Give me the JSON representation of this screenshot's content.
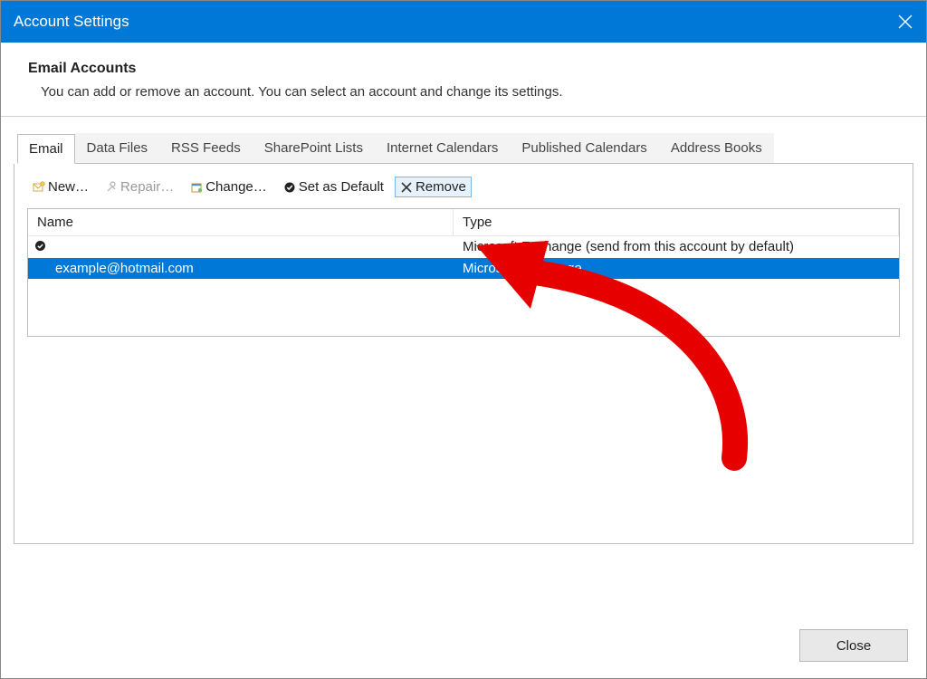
{
  "window": {
    "title": "Account Settings"
  },
  "header": {
    "heading": "Email Accounts",
    "subheading": "You can add or remove an account. You can select an account and change its settings."
  },
  "tabs": [
    {
      "label": "Email",
      "active": true
    },
    {
      "label": "Data Files"
    },
    {
      "label": "RSS Feeds"
    },
    {
      "label": "SharePoint Lists"
    },
    {
      "label": "Internet Calendars"
    },
    {
      "label": "Published Calendars"
    },
    {
      "label": "Address Books"
    }
  ],
  "toolbar": {
    "new_label": "New…",
    "repair_label": "Repair…",
    "change_label": "Change…",
    "default_label": "Set as Default",
    "remove_label": "Remove"
  },
  "table": {
    "col_name": "Name",
    "col_type": "Type",
    "rows": [
      {
        "name": "",
        "type": "Microsoft Exchange (send from this account by default)",
        "default": true
      },
      {
        "name": "example@hotmail.com",
        "type": "Microsoft Exchange",
        "selected": true
      }
    ]
  },
  "footer": {
    "close_label": "Close"
  }
}
